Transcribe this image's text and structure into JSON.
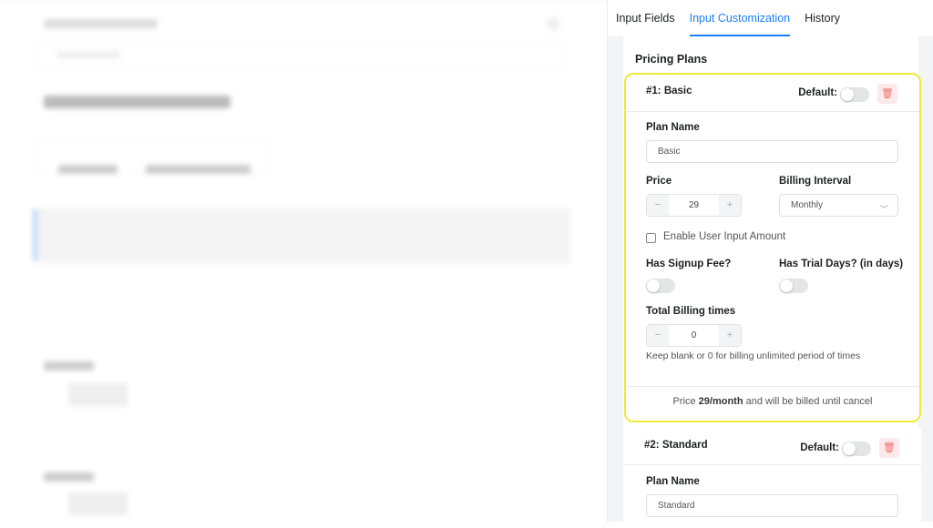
{
  "tabs": [
    {
      "label": "Input Fields"
    },
    {
      "label": "Input Customization",
      "active": true
    },
    {
      "label": "History"
    }
  ],
  "section_title": "Pricing Plans",
  "accent": "#1a7efb",
  "highlight_color": "#f0ea3a",
  "plans": [
    {
      "header": "#1: Basic",
      "default_label": "Default:",
      "default_on": false,
      "plan_name_label": "Plan Name",
      "plan_name": "Basic",
      "price_label": "Price",
      "price": "29",
      "billing_interval_label": "Billing Interval",
      "billing_interval": "Monthly",
      "user_input_label": "Enable User Input Amount",
      "user_input_checked": false,
      "signup_fee_label": "Has Signup Fee?",
      "signup_fee_on": false,
      "trial_label": "Has Trial Days? (in days)",
      "trial_on": false,
      "billing_times_label": "Total Billing times",
      "billing_times": "0",
      "billing_times_help": "Keep blank or 0 for billing unlimited period of times",
      "summary_prefix": "Price ",
      "summary_bold": "29/month",
      "summary_suffix": " and will be billed until cancel"
    },
    {
      "header": "#2: Standard",
      "default_label": "Default:",
      "default_on": false,
      "plan_name_label": "Plan Name",
      "plan_name": "Standard"
    }
  ],
  "icons": {
    "delete": "trash-icon",
    "minus": "minus-icon",
    "plus": "plus-icon",
    "dropdown": "chevron-down-icon"
  }
}
